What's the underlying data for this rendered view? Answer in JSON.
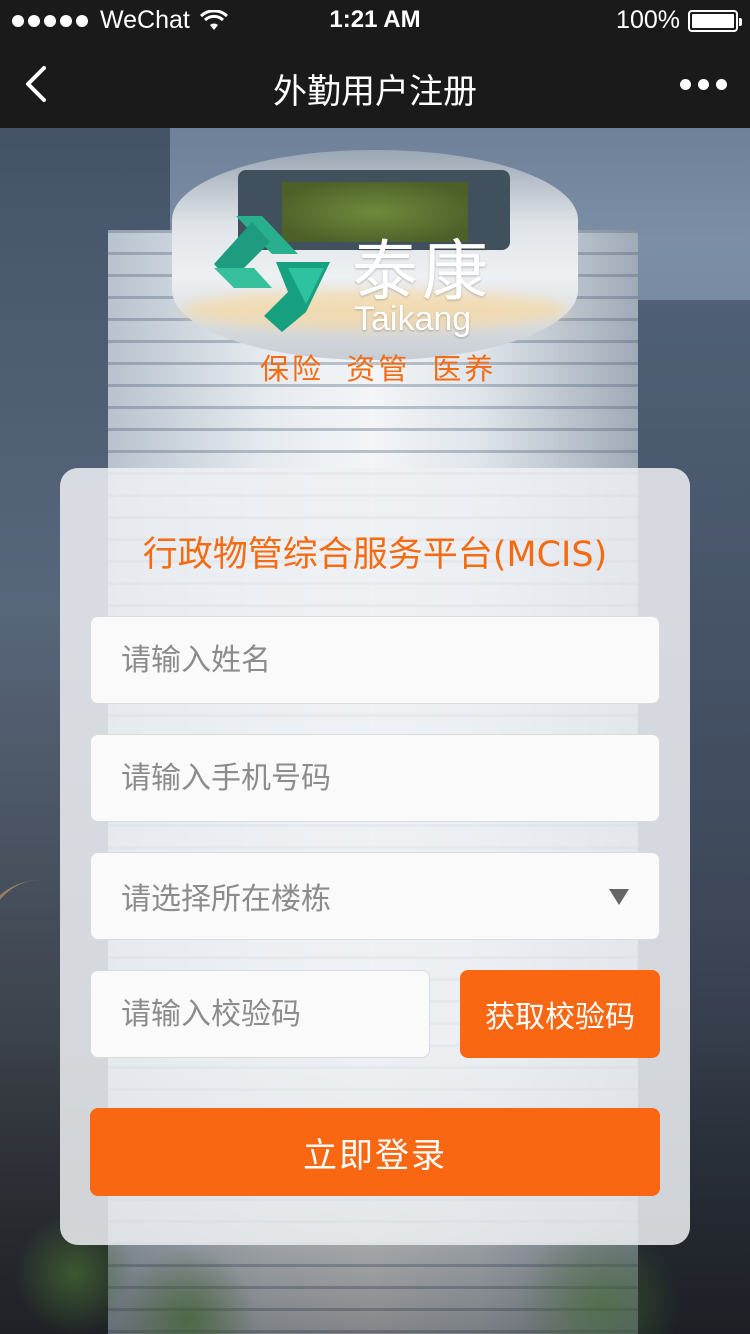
{
  "status_bar": {
    "carrier": "WeChat",
    "time": "1:21 AM",
    "battery": "100%"
  },
  "nav": {
    "title": "外勤用户注册"
  },
  "brand": {
    "name_cn": "泰康",
    "name_en": "Taikang",
    "slogan": "保险 资管 医养"
  },
  "form": {
    "platform_title": "行政物管综合服务平台(MCIS)",
    "name_placeholder": "请输入姓名",
    "phone_placeholder": "请输入手机号码",
    "building_placeholder": "请选择所在楼栋",
    "code_placeholder": "请输入校验码",
    "get_code_label": "获取校验码",
    "login_label": "立即登录"
  },
  "colors": {
    "accent": "#f96712",
    "logo_green": "#1aa383"
  },
  "icons": [
    "back-icon",
    "more-icon",
    "wifi-icon",
    "battery-icon",
    "dropdown-caret-icon",
    "taikang-logo-icon"
  ]
}
